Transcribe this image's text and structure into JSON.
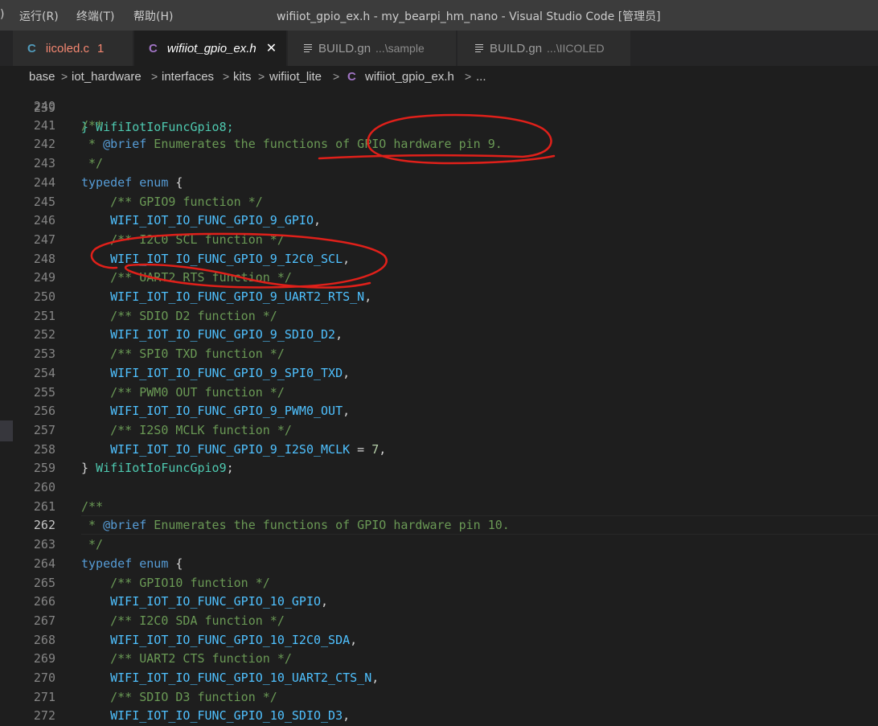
{
  "menu": {
    "fragment": ")",
    "items": [
      "运行(R)",
      "终端(T)",
      "帮助(H)"
    ]
  },
  "window_title": "wifiiot_gpio_ex.h - my_bearpi_hm_nano - Visual Studio Code [管理员]",
  "tabs": [
    {
      "icon": "c-file-icon",
      "icon_glyph": "C",
      "name": "iicoled.c",
      "badge": "1",
      "desc": "",
      "active": false
    },
    {
      "icon": "c-file-icon",
      "icon_glyph": "C",
      "name": "wifiiot_gpio_ex.h",
      "badge": "",
      "desc": "",
      "active": true,
      "close": "✕"
    },
    {
      "icon": "lines-file-icon",
      "icon_glyph": "",
      "name": "BUILD.gn",
      "badge": "",
      "desc": "...\\sample",
      "active": false
    },
    {
      "icon": "lines-file-icon",
      "icon_glyph": "",
      "name": "BUILD.gn",
      "badge": "",
      "desc": "...\\IICOLED",
      "active": false
    }
  ],
  "breadcrumb": {
    "items": [
      "base",
      "iot_hardware",
      "interfaces",
      "kits",
      "wifiiot_lite",
      "C",
      "wifiiot_gpio_ex.h",
      "..."
    ],
    "separator": ">"
  },
  "editor": {
    "top_partial": "} WifiIotIoFuncGpio8;",
    "top_partial_num": "239",
    "active_line": "262",
    "lines": [
      {
        "n": "240",
        "tokens": []
      },
      {
        "n": "241",
        "tokens": [
          [
            "comment",
            "/**"
          ]
        ]
      },
      {
        "n": "242",
        "tokens": [
          [
            "comment",
            " * "
          ],
          [
            "doctag",
            "@brief"
          ],
          [
            "comment",
            " Enumerates the functions of GPIO hardware pin 9."
          ]
        ]
      },
      {
        "n": "243",
        "tokens": [
          [
            "comment",
            " */"
          ]
        ]
      },
      {
        "n": "244",
        "tokens": [
          [
            "keyword",
            "typedef"
          ],
          [
            "plain",
            " "
          ],
          [
            "keyword",
            "enum"
          ],
          [
            "plain",
            " {"
          ]
        ]
      },
      {
        "n": "245",
        "tokens": [
          [
            "plain",
            "    "
          ],
          [
            "comment",
            "/** GPIO9 function */"
          ]
        ]
      },
      {
        "n": "246",
        "tokens": [
          [
            "plain",
            "    "
          ],
          [
            "enum",
            "WIFI_IOT_IO_FUNC_GPIO_9_GPIO"
          ],
          [
            "plain",
            ","
          ]
        ]
      },
      {
        "n": "247",
        "tokens": [
          [
            "plain",
            "    "
          ],
          [
            "comment",
            "/** I2C0 SCL function */"
          ]
        ]
      },
      {
        "n": "248",
        "tokens": [
          [
            "plain",
            "    "
          ],
          [
            "enum",
            "WIFI_IOT_IO_FUNC_GPIO_9_I2C0_SCL"
          ],
          [
            "plain",
            ","
          ]
        ]
      },
      {
        "n": "249",
        "tokens": [
          [
            "plain",
            "    "
          ],
          [
            "comment",
            "/** UART2 RTS function */"
          ]
        ]
      },
      {
        "n": "250",
        "tokens": [
          [
            "plain",
            "    "
          ],
          [
            "enum",
            "WIFI_IOT_IO_FUNC_GPIO_9_UART2_RTS_N"
          ],
          [
            "plain",
            ","
          ]
        ]
      },
      {
        "n": "251",
        "tokens": [
          [
            "plain",
            "    "
          ],
          [
            "comment",
            "/** SDIO D2 function */"
          ]
        ]
      },
      {
        "n": "252",
        "tokens": [
          [
            "plain",
            "    "
          ],
          [
            "enum",
            "WIFI_IOT_IO_FUNC_GPIO_9_SDIO_D2"
          ],
          [
            "plain",
            ","
          ]
        ]
      },
      {
        "n": "253",
        "tokens": [
          [
            "plain",
            "    "
          ],
          [
            "comment",
            "/** SPI0 TXD function */"
          ]
        ]
      },
      {
        "n": "254",
        "tokens": [
          [
            "plain",
            "    "
          ],
          [
            "enum",
            "WIFI_IOT_IO_FUNC_GPIO_9_SPI0_TXD"
          ],
          [
            "plain",
            ","
          ]
        ]
      },
      {
        "n": "255",
        "tokens": [
          [
            "plain",
            "    "
          ],
          [
            "comment",
            "/** PWM0 OUT function */"
          ]
        ]
      },
      {
        "n": "256",
        "tokens": [
          [
            "plain",
            "    "
          ],
          [
            "enum",
            "WIFI_IOT_IO_FUNC_GPIO_9_PWM0_OUT"
          ],
          [
            "plain",
            ","
          ]
        ]
      },
      {
        "n": "257",
        "tokens": [
          [
            "plain",
            "    "
          ],
          [
            "comment",
            "/** I2S0 MCLK function */"
          ]
        ]
      },
      {
        "n": "258",
        "tokens": [
          [
            "plain",
            "    "
          ],
          [
            "enum",
            "WIFI_IOT_IO_FUNC_GPIO_9_I2S0_MCLK"
          ],
          [
            "plain",
            " = "
          ],
          [
            "num",
            "7"
          ],
          [
            "plain",
            ","
          ]
        ]
      },
      {
        "n": "259",
        "tokens": [
          [
            "plain",
            "} "
          ],
          [
            "type",
            "WifiIotIoFuncGpio9"
          ],
          [
            "plain",
            ";"
          ]
        ]
      },
      {
        "n": "260",
        "tokens": []
      },
      {
        "n": "261",
        "tokens": [
          [
            "comment",
            "/**"
          ]
        ]
      },
      {
        "n": "262",
        "tokens": [
          [
            "comment",
            " * "
          ],
          [
            "doctag",
            "@brief"
          ],
          [
            "comment",
            " Enumerates the functions of GPIO hardware pin 10."
          ]
        ]
      },
      {
        "n": "263",
        "tokens": [
          [
            "comment",
            " */"
          ]
        ]
      },
      {
        "n": "264",
        "tokens": [
          [
            "keyword",
            "typedef"
          ],
          [
            "plain",
            " "
          ],
          [
            "keyword",
            "enum"
          ],
          [
            "plain",
            " {"
          ]
        ]
      },
      {
        "n": "265",
        "tokens": [
          [
            "plain",
            "    "
          ],
          [
            "comment",
            "/** GPIO10 function */"
          ]
        ]
      },
      {
        "n": "266",
        "tokens": [
          [
            "plain",
            "    "
          ],
          [
            "enum",
            "WIFI_IOT_IO_FUNC_GPIO_10_GPIO"
          ],
          [
            "plain",
            ","
          ]
        ]
      },
      {
        "n": "267",
        "tokens": [
          [
            "plain",
            "    "
          ],
          [
            "comment",
            "/** I2C0 SDA function */"
          ]
        ]
      },
      {
        "n": "268",
        "tokens": [
          [
            "plain",
            "    "
          ],
          [
            "enum",
            "WIFI_IOT_IO_FUNC_GPIO_10_I2C0_SDA"
          ],
          [
            "plain",
            ","
          ]
        ]
      },
      {
        "n": "269",
        "tokens": [
          [
            "plain",
            "    "
          ],
          [
            "comment",
            "/** UART2 CTS function */"
          ]
        ]
      },
      {
        "n": "270",
        "tokens": [
          [
            "plain",
            "    "
          ],
          [
            "enum",
            "WIFI_IOT_IO_FUNC_GPIO_10_UART2_CTS_N"
          ],
          [
            "plain",
            ","
          ]
        ]
      },
      {
        "n": "271",
        "tokens": [
          [
            "plain",
            "    "
          ],
          [
            "comment",
            "/** SDIO D3 function */"
          ]
        ]
      },
      {
        "n": "272",
        "tokens": [
          [
            "plain",
            "    "
          ],
          [
            "enum",
            "WIFI_IOT_IO_FUNC_GPIO_10_SDIO_D3"
          ],
          [
            "plain",
            ","
          ]
        ]
      }
    ]
  },
  "annotations": [
    {
      "name": "red-circle-annotation-gpio9",
      "color": "#e0201a"
    },
    {
      "name": "red-circle-annotation-i2c0-scl",
      "color": "#e0201a"
    }
  ],
  "colors": {
    "titlebar": "#3c3c3c",
    "tabbar": "#252526",
    "editor_bg": "#1e1e1e",
    "annotation_red": "#e0201a"
  }
}
